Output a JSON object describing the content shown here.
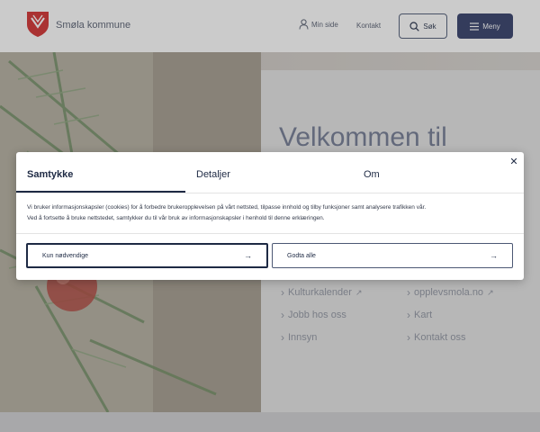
{
  "colors": {
    "navy": "#1e2a44",
    "menu_button": "#2e3a66",
    "brand_red": "#d22b2b",
    "overlay": "rgba(70,70,70,0.28)"
  },
  "header": {
    "brand_name": "Smøla kommune",
    "logo_icon": "coat-of-arms-icon",
    "my_page_label": "Min side",
    "my_page_icon": "person-icon",
    "contact_label": "Kontakt",
    "search_label": "Søk",
    "search_icon": "search-icon",
    "menu_label": "Meny",
    "menu_icon": "hamburger-icon"
  },
  "hero": {
    "welcome_title": "Velkommen til",
    "links": [
      {
        "label": "Kulturkalender",
        "external": true
      },
      {
        "label": "opplevsmola.no",
        "external": true
      },
      {
        "label": "Jobb hos oss",
        "external": false
      },
      {
        "label": "Kart",
        "external": false
      },
      {
        "label": "Innsyn",
        "external": false
      },
      {
        "label": "Kontakt oss",
        "external": false
      }
    ]
  },
  "cookie_dialog": {
    "tabs": [
      "Samtykke",
      "Detaljer",
      "Om"
    ],
    "active_tab": "Samtykke",
    "close_icon": "close-icon",
    "text_line_1": "Vi bruker informasjonskapsler (cookies) for å forbedre brukeropplevelsen på vårt nettsted, tilpasse innhold og tilby funksjoner samt analysere trafikken vår.",
    "text_line_2": "Ved å fortsette å bruke nettstedet, samtykker du til vår bruk av informasjonskapsler i henhold til denne erklæringen.",
    "necessary_only_label": "Kun nødvendige",
    "accept_all_label": "Godta alle",
    "arrow_icon": "arrow-right-icon"
  }
}
